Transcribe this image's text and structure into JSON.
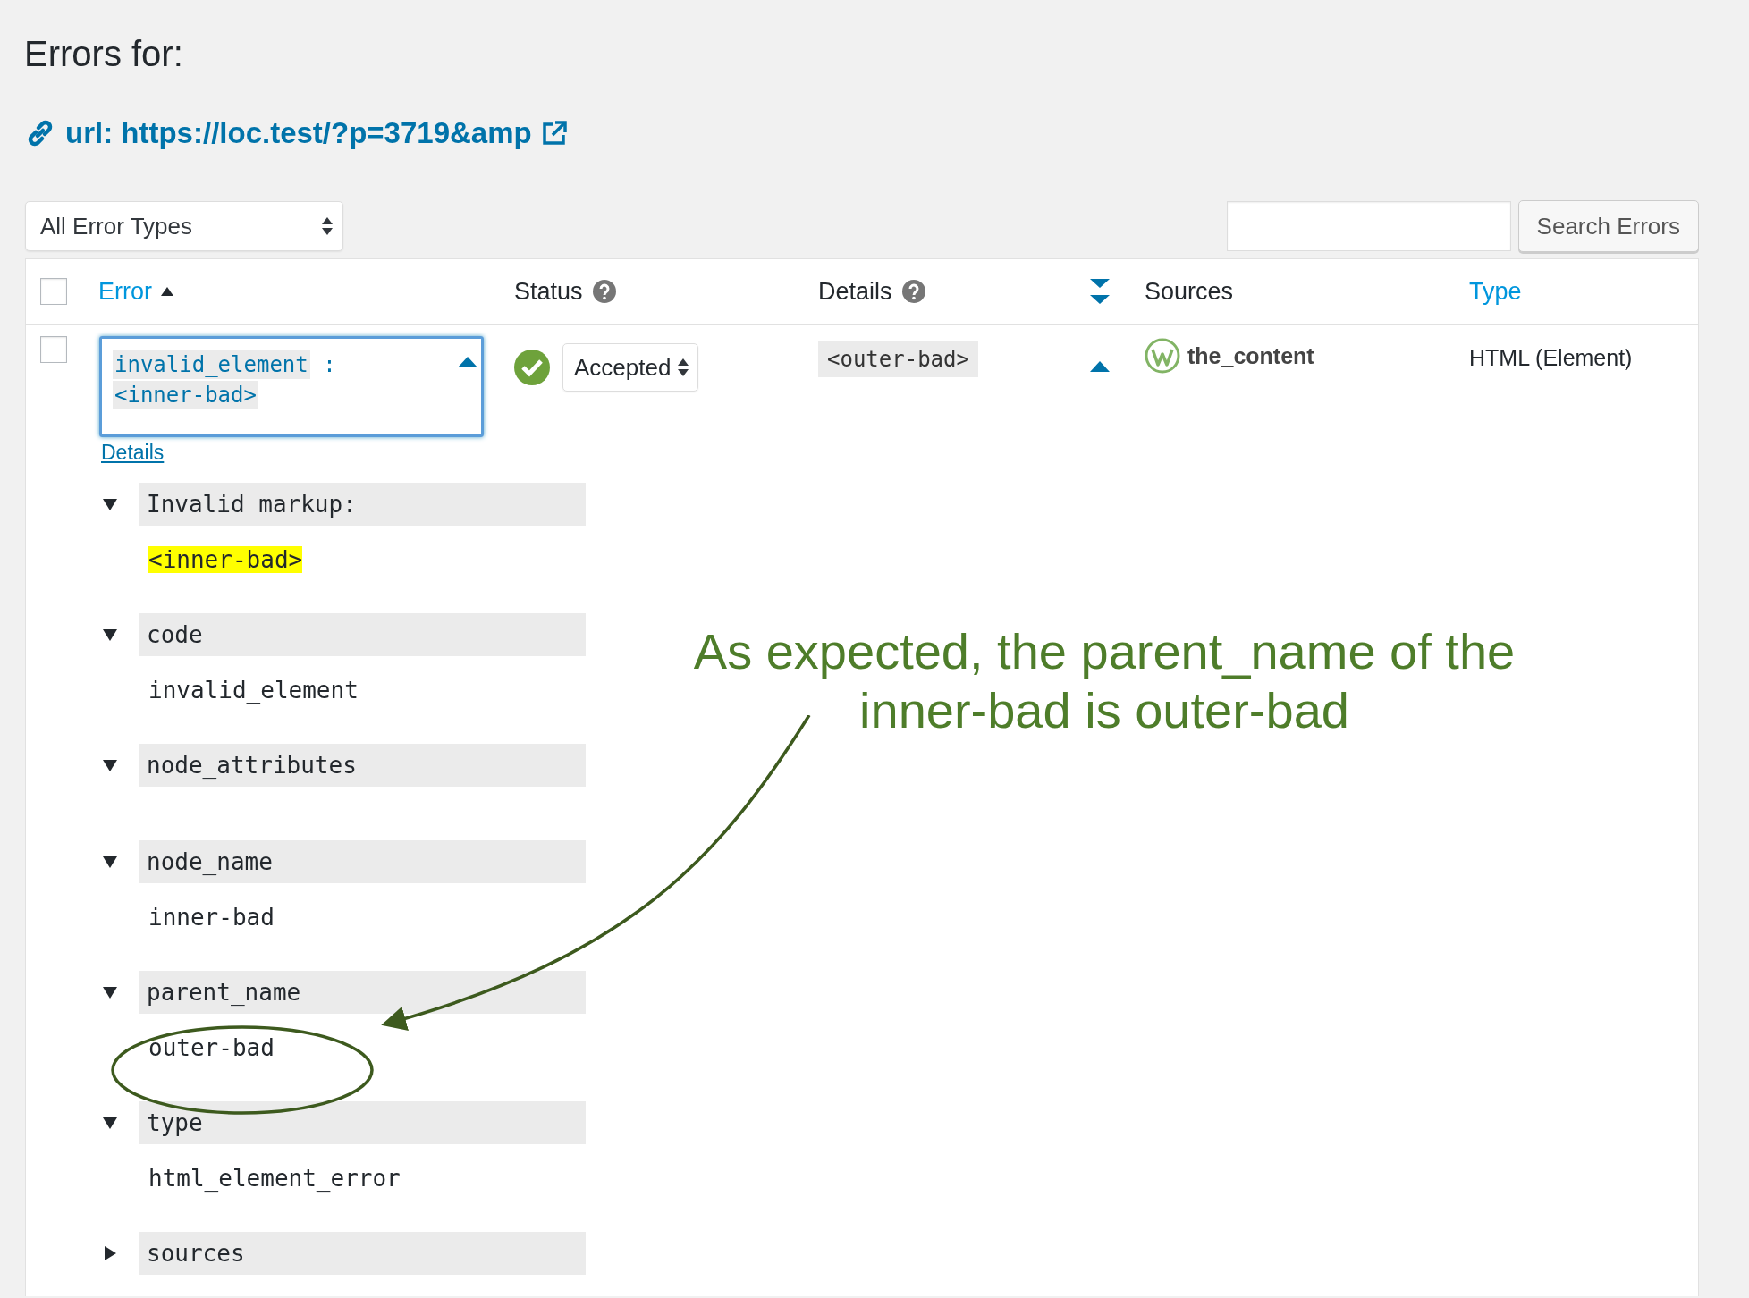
{
  "page": {
    "title": "Errors for:",
    "url_link": "url: https://loc.test/?p=3719&amp"
  },
  "toolbar": {
    "error_type_filter": "All Error Types",
    "search_button": "Search Errors"
  },
  "table": {
    "select_all_checked": false,
    "columns": [
      {
        "kind": "sortable",
        "label": "Error",
        "sorted": true
      },
      {
        "kind": "help",
        "label": "Status"
      },
      {
        "kind": "help",
        "label": "Details"
      },
      {
        "kind": "toggle"
      },
      {
        "kind": "plain",
        "label": "Sources"
      },
      {
        "kind": "link",
        "label": "Type"
      }
    ],
    "rows": [
      {
        "checked": false,
        "expanded": true,
        "error": {
          "code": "invalid_element",
          "separator": ":",
          "markup": "<inner-bad>"
        },
        "details_link": "Details",
        "status": {
          "kind": "accepted",
          "label": "Accepted"
        },
        "details_code": "<outer-bad>",
        "source": "the_content",
        "type": "HTML (Element)",
        "details": [
          {
            "label": "Invalid markup:",
            "expanded": true,
            "value": "<inner-bad>",
            "highlight": true
          },
          {
            "label": "code",
            "expanded": true,
            "value": "invalid_element",
            "highlight": false
          },
          {
            "label": "node_attributes",
            "expanded": true
          },
          {
            "label": "node_name",
            "expanded": true,
            "value": "inner-bad",
            "highlight": false
          },
          {
            "label": "parent_name",
            "expanded": true,
            "value": "outer-bad",
            "highlight": false
          },
          {
            "label": "type",
            "expanded": true,
            "value": "html_element_error",
            "highlight": false
          },
          {
            "label": "sources",
            "expanded": false
          }
        ]
      }
    ]
  },
  "annotation": {
    "lines": [
      "As expected, the parent_name of the",
      "inner-bad is outer-bad"
    ]
  }
}
